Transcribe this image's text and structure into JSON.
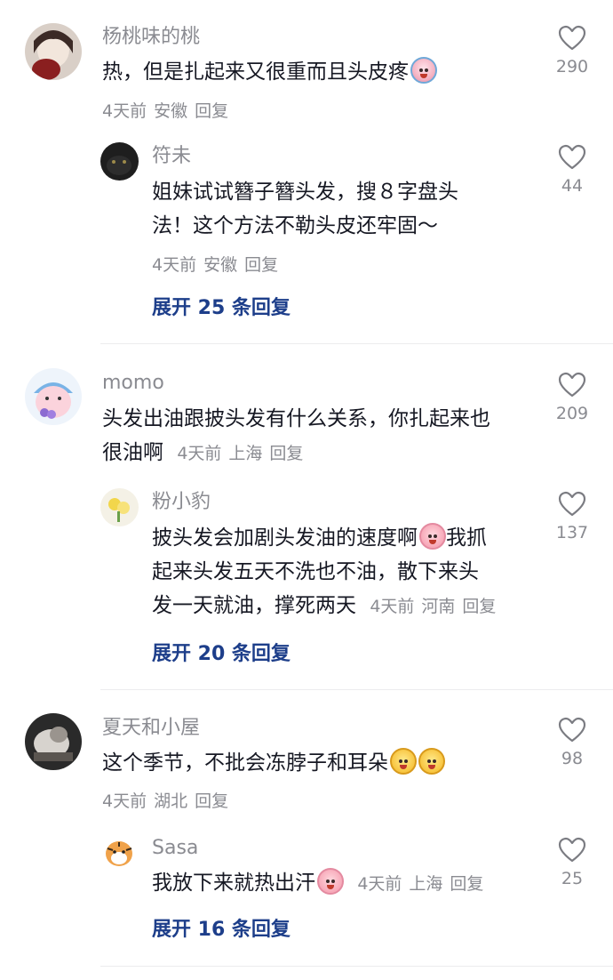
{
  "threads": [
    {
      "comment": {
        "name": "杨桃味的桃",
        "text": "热，但是扎起来又很重而且头皮疼",
        "emoji": "crying-emoji",
        "date": "4天前",
        "location": "安徽",
        "reply_label": "回复",
        "likes": "290"
      },
      "reply": {
        "name": "符未",
        "text_line1": "姐妹试试簪子簪头发，搜８字盘头",
        "text_line2": "法！这个方法不勒头皮还牢固～",
        "date": "4天前",
        "location": "安徽",
        "reply_label": "回复",
        "likes": "44"
      },
      "expand_label": "展开 25 条回复"
    },
    {
      "comment": {
        "name": "momo",
        "text_line1": "头发出油跟披头发有什么关系，你扎起来也",
        "text_line2": "很油啊",
        "date": "4天前",
        "location": "上海",
        "reply_label": "回复",
        "likes": "209"
      },
      "reply": {
        "name": "粉小豹",
        "text_line1a": "披头发会加剧头发油的速度啊",
        "emoji": "pig-emoji",
        "text_line1b": "我抓",
        "text_line2": "起来头发五天不洗也不油，散下来头",
        "text_line3": "发一天就油，撑死两天",
        "date": "4天前",
        "location": "河南",
        "reply_label": "回复",
        "likes": "137"
      },
      "expand_label": "展开 20 条回复"
    },
    {
      "comment": {
        "name": "夏天和小屋",
        "text": "这个季节，不批会冻脖子和耳朵",
        "emoji": "chick-emoji",
        "date": "4天前",
        "location": "湖北",
        "reply_label": "回复",
        "likes": "98"
      },
      "reply": {
        "name": "Sasa",
        "text": "我放下来就热出汗",
        "emoji": "pig-emoji",
        "date": "4天前",
        "location": "上海",
        "reply_label": "回复",
        "likes": "25"
      },
      "expand_label": "展开 16 条回复"
    }
  ],
  "colors": {
    "name": "#8a8b91",
    "text": "#161823",
    "expand": "#1d3e8a",
    "divider": "#ececee"
  }
}
